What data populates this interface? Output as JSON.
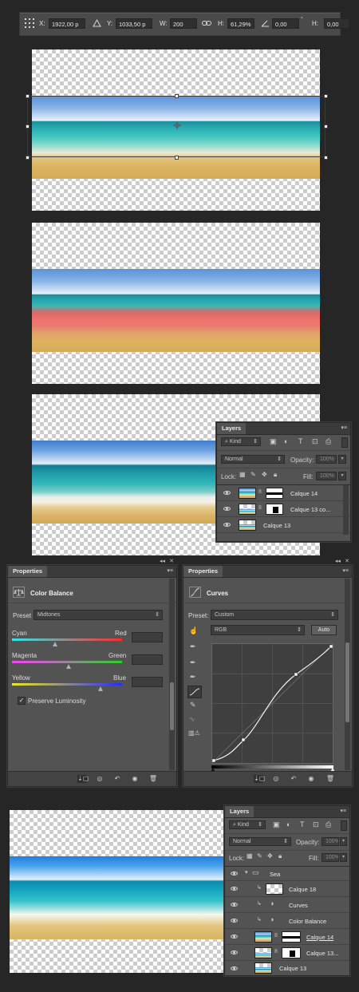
{
  "options_bar": {
    "x_label": "X:",
    "x_value": "1922,00 p",
    "y_label": "Y:",
    "y_value": "1033,50 p",
    "w_label": "W:",
    "w_value": "200",
    "h_label": "H:",
    "h_value": "61,29%",
    "angle_value": "0,00",
    "h_skew_label": "H:",
    "h_skew_value": "0,00"
  },
  "layers_panel_1": {
    "tab": "Layers",
    "kind_label": "Kind",
    "blend_mode": "Normal",
    "opacity_label": "Opacity:",
    "opacity_value": "100%",
    "lock_label": "Lock:",
    "fill_label": "Fill:",
    "fill_value": "100%",
    "layers": [
      {
        "name": "Calque 14"
      },
      {
        "name": "Calque 13 co..."
      },
      {
        "name": "Calque 13"
      }
    ]
  },
  "color_balance_panel": {
    "tab": "Properties",
    "title": "Color Balance",
    "preset_label": "Preset",
    "preset_value": "Midtones",
    "sliders": [
      {
        "left": "Cyan",
        "right": "Red",
        "value": 0.49
      },
      {
        "left": "Magenta",
        "right": "Green",
        "value": 0.55
      },
      {
        "left": "Yellow",
        "right": "Blue",
        "value": 0.82
      }
    ],
    "preserve_luminosity": "Preserve Luminosity",
    "preserve_checked": true
  },
  "curves_panel": {
    "tab": "Properties",
    "title": "Curves",
    "preset_label": "Preset:",
    "preset_value": "Custom",
    "channel": "RGB",
    "auto_label": "Auto"
  },
  "layers_panel_2": {
    "tab": "Layers",
    "kind_label": "Kind",
    "blend_mode": "Normal",
    "opacity_label": "Opacity:",
    "opacity_value": "100%",
    "lock_label": "Lock:",
    "fill_label": "Fill:",
    "fill_value": "100%",
    "layers": [
      {
        "name": "Sea"
      },
      {
        "name": "Calque 18"
      },
      {
        "name": "Curves"
      },
      {
        "name": "Color Balance"
      },
      {
        "name": "Calque 14"
      },
      {
        "name": "Calque 13..."
      },
      {
        "name": "Calque 13"
      }
    ]
  },
  "colors": {
    "panel_bg": "#535353",
    "app_bg": "#262626",
    "input_bg": "#3d3d3d"
  }
}
